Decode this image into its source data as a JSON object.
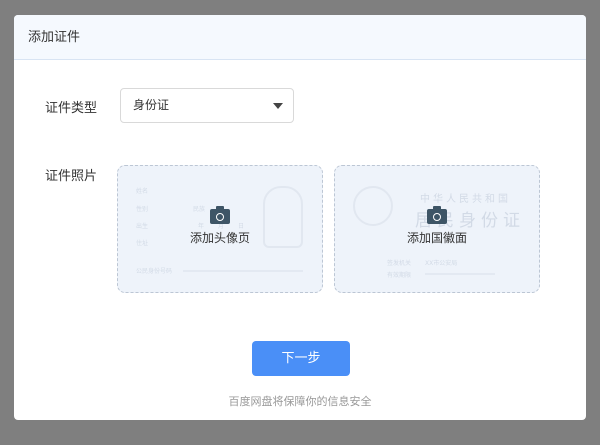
{
  "dialog": {
    "title": "添加证件"
  },
  "form": {
    "type_label": "证件类型",
    "type_value": "身份证",
    "photo_label": "证件照片",
    "front": {
      "label": "添加头像页",
      "fields": [
        "姓名",
        "性别",
        "民族",
        "出生",
        "年",
        "月",
        "日",
        "住址",
        "公民身份号码"
      ]
    },
    "back": {
      "label": "添加国徽面",
      "title1": "中华人民共和国",
      "title2": "居民身份证",
      "fields": [
        "签发机关",
        "XX市公安局",
        "有效期限"
      ]
    }
  },
  "next_button": "下一步",
  "security_note": "百度网盘将保障你的信息安全",
  "colors": {
    "primary": "#4a8ff7",
    "header_bg": "#f5f9fe"
  }
}
